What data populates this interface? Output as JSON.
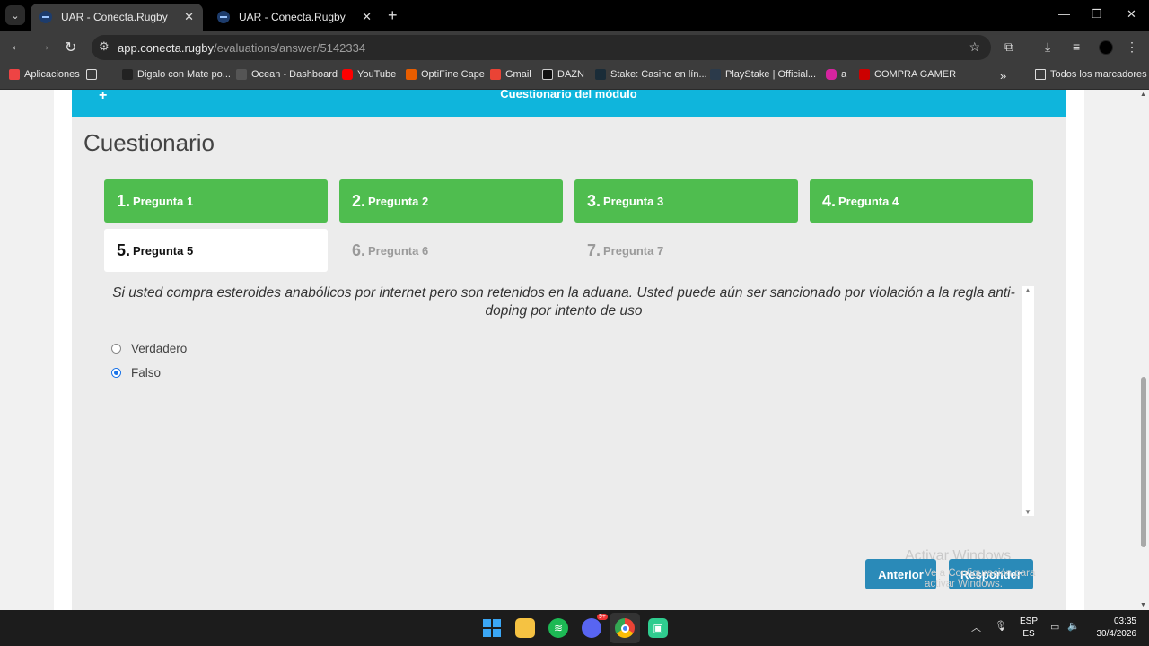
{
  "browser": {
    "tabs": [
      {
        "title": "UAR - Conecta.Rugby",
        "active": true
      },
      {
        "title": "UAR - Conecta.Rugby",
        "active": false
      }
    ],
    "url_host": "app.conecta.rugby",
    "url_path": "/evaluations/answer/5142334",
    "bookmarks": [
      {
        "label": "Aplicaciones",
        "icon": "apps-grid-icon"
      },
      {
        "label": "Digalo con Mate po...",
        "icon": "bookmark-icon"
      },
      {
        "label": "Ocean - Dashboard",
        "icon": "ocean-icon"
      },
      {
        "label": "YouTube",
        "icon": "youtube-icon"
      },
      {
        "label": "OptiFine Cape",
        "icon": "optifine-icon"
      },
      {
        "label": "Gmail",
        "icon": "gmail-icon"
      },
      {
        "label": "DAZN",
        "icon": "dazn-icon"
      },
      {
        "label": "Stake: Casino en lín...",
        "icon": "stake-icon"
      },
      {
        "label": "PlayStake | Official...",
        "icon": "playstake-icon"
      },
      {
        "label": "a",
        "icon": "instagram-icon"
      },
      {
        "label": "COMPRA GAMER",
        "icon": "compragamer-icon"
      }
    ],
    "all_bookmarks": "Todos los marcadores"
  },
  "module": {
    "plus": "+",
    "title": "Cuestionario del módulo"
  },
  "quiz": {
    "title": "Cuestionario",
    "questions": [
      {
        "num": "1.",
        "label": "Pregunta 1",
        "state": "done"
      },
      {
        "num": "2.",
        "label": "Pregunta 2",
        "state": "done"
      },
      {
        "num": "3.",
        "label": "Pregunta 3",
        "state": "done"
      },
      {
        "num": "4.",
        "label": "Pregunta 4",
        "state": "done"
      },
      {
        "num": "5.",
        "label": "Pregunta 5",
        "state": "current"
      },
      {
        "num": "6.",
        "label": "Pregunta 6",
        "state": "pending"
      },
      {
        "num": "7.",
        "label": "Pregunta 7",
        "state": "pending"
      }
    ],
    "question_text": "Si usted compra esteroides anabólicos por internet pero son retenidos en la aduana. Usted puede aún ser sancionado por violación a la regla anti-doping por intento de uso",
    "options": [
      {
        "label": "Verdadero",
        "checked": false
      },
      {
        "label": "Falso",
        "checked": true
      }
    ],
    "prev_label": "Anterior",
    "submit_label": "Responder"
  },
  "watermark": {
    "line1": "Activar Windows",
    "line2": "Ve a Configuración para activar Windows."
  },
  "taskbar": {
    "lang_top": "ESP",
    "lang_bottom": "ES",
    "time": "03:35",
    "date": "30/4/2026",
    "discord_badge": "9+"
  },
  "colors": {
    "done": "#4fbd4f",
    "module_bar": "#0fb5dc",
    "button": "#2a8ab8"
  }
}
